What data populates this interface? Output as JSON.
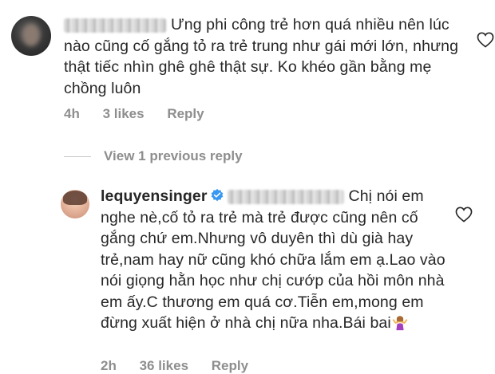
{
  "comments": [
    {
      "text": "Ưng phi công trẻ hơn quá nhiều nên lúc nào cũng cố gắng tỏ ra trẻ trung như gái mới lớn, nhưng thật tiếc nhìn ghê ghê thật sự. Ko khéo gần bằng mẹ chồng luôn",
      "time": "4h",
      "likes": "3 likes",
      "reply_label": "Reply"
    }
  ],
  "view_replies_label": "View 1 previous reply",
  "reply": {
    "username": "lequyensinger",
    "text": "Chị nói em nghe nè,cố tỏ ra trẻ mà trẻ được cũng nên cố gắng chứ em.Nhưng vô duyên thì dù già hay trẻ,nam hay nữ cũng khó chữa lắm em ạ.Lao vào nói giọng hằn học như chị cướp của hồi môn nhà em ấy.C thương em quá cơ.Tiễn em,mong em đừng xuất hiện ở nhà chị nữa nha.Bái bai",
    "time": "2h",
    "likes": "36 likes",
    "reply_label": "Reply"
  },
  "icons": {
    "heart": "heart-outline-icon",
    "verified": "verified-badge-icon",
    "emoji": "woman-shrugging-emoji"
  },
  "colors": {
    "text": "#262626",
    "meta": "#8e8e8e",
    "verified": "#3897f0"
  }
}
